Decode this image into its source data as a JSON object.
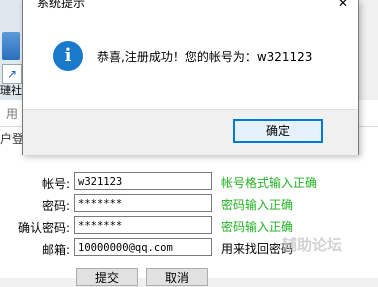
{
  "dialog": {
    "title": "系统提示",
    "message": "恭喜,注册成功！您的帐号为：w321123",
    "ok_label": "确定",
    "close_glyph": "✕",
    "icon": "information-icon"
  },
  "desktop": {
    "label": "璉社"
  },
  "register_window": {
    "title": "用",
    "subtitle": "户登",
    "fields": [
      {
        "label": "帐号:",
        "value": "w321123",
        "hint": "帐号格式输入正确"
      },
      {
        "label": "密码:",
        "value": "*******",
        "hint": "密码输入正确"
      },
      {
        "label": "确认密码:",
        "value": "*******",
        "hint": "密码输入正确"
      },
      {
        "label": "邮箱:",
        "value": "10000000@qq.com",
        "hint": "用来找回密码"
      }
    ],
    "submit_label": "提交",
    "cancel_label": "取消",
    "watermark": "辅助论坛"
  }
}
